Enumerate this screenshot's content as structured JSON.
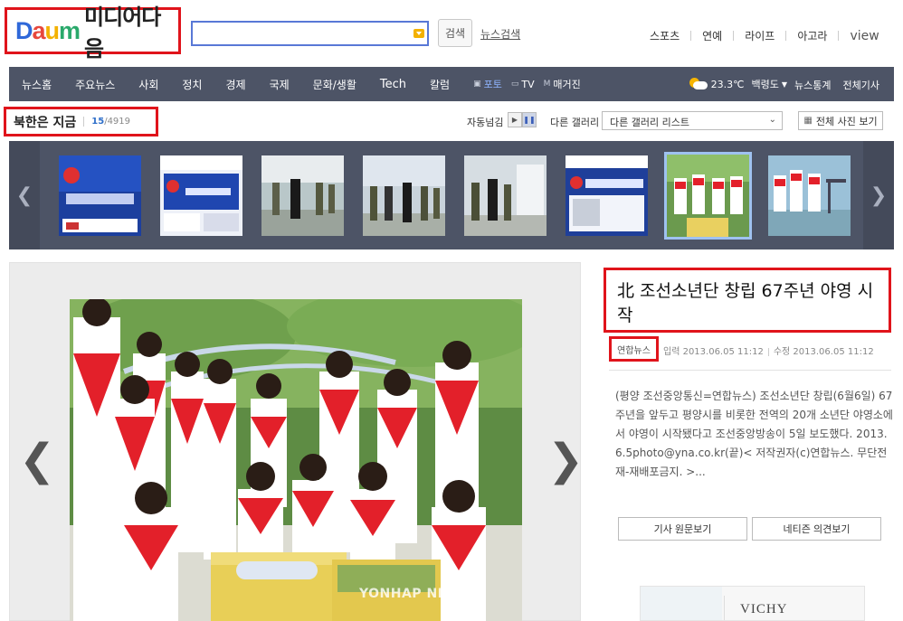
{
  "header": {
    "logo_daum": "Daum",
    "logo_media": "미디어다음",
    "search_value": "",
    "search_button": "검색",
    "news_search": "뉴스검색",
    "top_links": [
      "스포츠",
      "연예",
      "라이프",
      "아고라",
      "view"
    ]
  },
  "nav": {
    "items": [
      "뉴스홈",
      "주요뉴스",
      "사회",
      "정치",
      "경제",
      "국제",
      "문화/생활",
      "Tech",
      "칼럼"
    ],
    "media": [
      {
        "label": "포토",
        "active": true
      },
      {
        "label": "TV",
        "active": false
      },
      {
        "label": "매거진",
        "active": false
      }
    ],
    "weather": {
      "temp": "23.3℃",
      "location": "백령도",
      "icon": "partly-cloudy-icon"
    },
    "right_links": [
      "뉴스통계",
      "전체기사"
    ]
  },
  "gallery": {
    "title": "북한은 지금",
    "current": "15",
    "total": "/4919",
    "auto_label": "자동넘김",
    "other_label": "다른 갤러리",
    "select_value": "다른 갤러리 리스트",
    "all_photos": "전체 사진 보기",
    "thumbs": [
      {
        "name": "thumb-kctv-screen"
      },
      {
        "name": "thumb-kctv-website"
      },
      {
        "name": "thumb-leader-visit-1"
      },
      {
        "name": "thumb-leader-visit-2"
      },
      {
        "name": "thumb-leader-visit-3"
      },
      {
        "name": "thumb-leader-visit-4"
      },
      {
        "name": "thumb-kctv-website-2"
      },
      {
        "name": "thumb-children-camp",
        "selected": true
      },
      {
        "name": "thumb-children-boat"
      }
    ]
  },
  "photo": {
    "watermark": "YONHAP NEWS"
  },
  "article": {
    "title": "北 조선소년단 창립 67주년 야영 시작",
    "source": "연합뉴스",
    "input_date": "입력 2013.06.05 11:12",
    "edit_date": "수정 2013.06.05 11:12",
    "body": "(평양 조선중앙통신=연합뉴스) 조선소년단 창립(6월6일) 67주년을 앞두고 평양시를 비롯한 전역의 20개 소년단 야영소에서 야영이 시작됐다고 조선중앙방송이 5일 보도했다. 2013.6.5photo@yna.co.kr(끝)< 저작권자(c)연합뉴스. 무단전재-재배포금지. >...",
    "btn_original": "기사 원문보기",
    "btn_comments": "네티즌 의견보기"
  },
  "ad": {
    "brand": "VICHY"
  },
  "colors": {
    "nav_bg": "#4d5466",
    "highlight_red": "#e0141b",
    "search_border": "#5878d6"
  }
}
